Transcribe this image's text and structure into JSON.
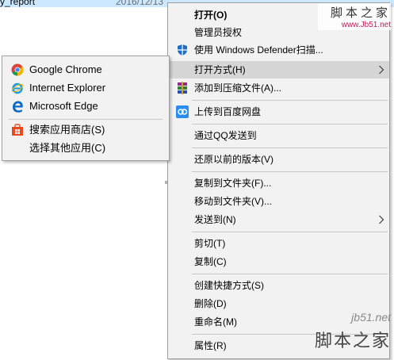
{
  "explorer": {
    "file_name": "y_report",
    "file_date": "2016/12/13"
  },
  "context_menu": {
    "items": [
      {
        "label": "打开(O)",
        "icon": "none"
      },
      {
        "label": "管理员授权",
        "icon": "none"
      },
      {
        "label": "使用 Windows Defender扫描...",
        "icon": "windows-defender-icon"
      },
      {
        "label": "打开方式(H)",
        "icon": "none"
      },
      {
        "label": "添加到压缩文件(A)...",
        "icon": "winrar-icon"
      },
      {
        "label": "上传到百度网盘",
        "icon": "baidu-netdisk-icon"
      },
      {
        "label": "通过QQ发送到",
        "icon": "none"
      },
      {
        "label": "还原以前的版本(V)",
        "icon": "none"
      },
      {
        "label": "复制到文件夹(F)...",
        "icon": "none"
      },
      {
        "label": "移动到文件夹(V)...",
        "icon": "none"
      },
      {
        "label": "发送到(N)",
        "icon": "none"
      },
      {
        "label": "剪切(T)",
        "icon": "none"
      },
      {
        "label": "复制(C)",
        "icon": "none"
      },
      {
        "label": "创建快捷方式(S)",
        "icon": "none"
      },
      {
        "label": "删除(D)",
        "icon": "none"
      },
      {
        "label": "重命名(M)",
        "icon": "none"
      },
      {
        "label": "属性(R)",
        "icon": "none"
      }
    ],
    "submenu_arrow_icon": "chevron-right-icon"
  },
  "open_with_submenu": {
    "items": [
      {
        "label": "Google Chrome",
        "icon": "chrome-icon"
      },
      {
        "label": "Internet Explorer",
        "icon": "internet-explorer-icon"
      },
      {
        "label": "Microsoft Edge",
        "icon": "edge-icon"
      },
      {
        "label": "搜索应用商店(S)",
        "icon": "store-icon"
      },
      {
        "label": "选择其他应用(C)",
        "icon": "none"
      }
    ]
  },
  "watermarks": {
    "top_title": "脚本之家",
    "top_url": "www.Jb51.net",
    "bottom_url": "jb51.net",
    "bottom_title": "脚本之家"
  },
  "colors": {
    "menu_background": "#f2f2f2",
    "hover_background": "#d6d6d6",
    "selection_highlight": "#cce8ff"
  }
}
